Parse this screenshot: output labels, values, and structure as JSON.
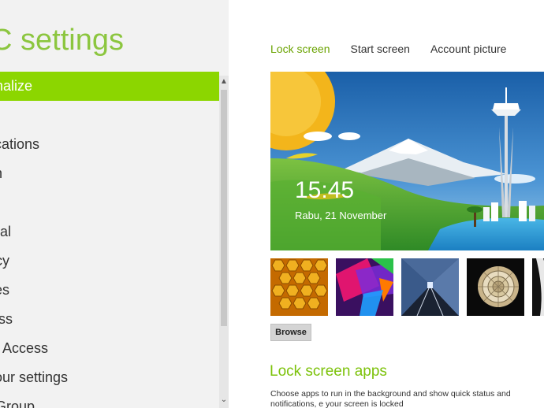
{
  "left_pane": {
    "title": "C settings",
    "menu": [
      {
        "label": "onalize",
        "active": true
      },
      {
        "label": "s",
        "active": false
      },
      {
        "label": "fications",
        "active": false
      },
      {
        "label": "ch",
        "active": false
      },
      {
        "label": "e",
        "active": false
      },
      {
        "label": "eral",
        "active": false
      },
      {
        "label": "acy",
        "active": false
      },
      {
        "label": "ces",
        "active": false
      },
      {
        "label": "less",
        "active": false
      },
      {
        "label": " of Access",
        "active": false
      },
      {
        "label": " your settings",
        "active": false
      },
      {
        "label": "eGroup",
        "active": false
      }
    ]
  },
  "tabs": [
    {
      "label": "Lock screen",
      "active": true
    },
    {
      "label": "Start screen",
      "active": false
    },
    {
      "label": "Account picture",
      "active": false
    }
  ],
  "lock_preview": {
    "time": "15:45",
    "date": "Rabu, 21 November"
  },
  "thumbnails": [
    "honeycomb",
    "colorful-shapes",
    "train-tunnel",
    "nautilus-shell",
    "abstract"
  ],
  "browse_label": "Browse",
  "lock_screen_apps": {
    "title": "Lock screen apps",
    "description": "Choose apps to run in the background and show quick status and notifications, e your screen is locked"
  },
  "colors": {
    "accent": "#8cd600",
    "accent_text": "#6aa300",
    "left_background": "#f2f2f2"
  }
}
